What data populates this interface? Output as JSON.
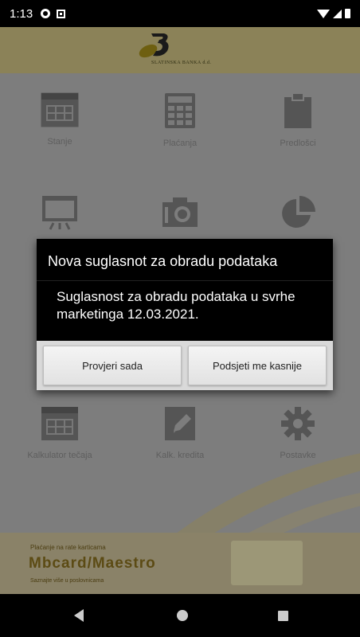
{
  "status_bar": {
    "time": "1:13"
  },
  "brand": {
    "logo_text": "SLATINSKA BANKA d.d."
  },
  "grid": [
    {
      "label": "Stanje",
      "icon": "calendar-icon"
    },
    {
      "label": "Plaćanja",
      "icon": "calculator-icon"
    },
    {
      "label": "Predlošci",
      "icon": "clipboard-icon"
    },
    {
      "label": "",
      "icon": "presentation-icon"
    },
    {
      "label": "",
      "icon": "camera-icon"
    },
    {
      "label": "",
      "icon": "pie-chart-icon"
    },
    {
      "label": "Kalkulator tečaja",
      "icon": "calendar-icon"
    },
    {
      "label": "Kalk. kredita",
      "icon": "edit-icon"
    },
    {
      "label": "Postavke",
      "icon": "gear-icon"
    }
  ],
  "banner": {
    "line1": "Plaćanje na rate karticama",
    "line2": "Mbcard/Maestro",
    "line3": "Saznajte više u poslovnicama"
  },
  "dialog": {
    "title": "Nova suglasnot za obradu podataka",
    "message": "Suglasnost za obradu podataka u svrhe marketinga 12.03.2021.",
    "primary_button": "Provjeri sada",
    "secondary_button": "Podsjeti me kasnije"
  },
  "colors": {
    "dim_background": "#7d7d7d",
    "dialog_background": "#000000",
    "button_bar": "#d9d9d9"
  }
}
